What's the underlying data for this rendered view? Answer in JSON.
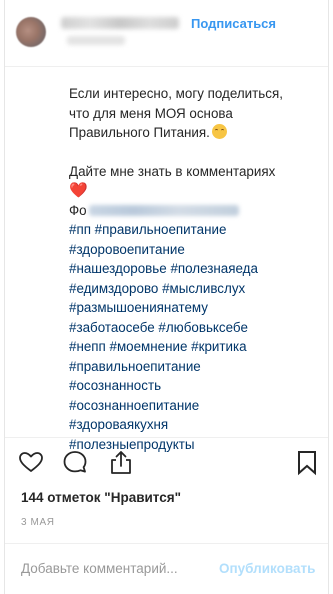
{
  "header": {
    "follow_label": "Подписаться"
  },
  "caption": {
    "lines": [
      "Если интересно, могу поделиться,",
      "что для меня МОЯ основа",
      "Правильного Питания."
    ],
    "ask_line": "Дайте мне знать в комментариях",
    "fo_prefix": "Фо",
    "hashtags": [
      "#пп #правильноепитание",
      "#здоровоепитание",
      "#нашездоровье #полезнаяеда",
      "#едимздорово #мысливслух",
      "#размышоениянатему",
      "#заботаосебе #любовьксебе",
      "#непп #моемнение #критика",
      "#правильноепитание",
      "#осознанность",
      "#осознанноепитание",
      "#здороваякухня",
      "#полезныепродукты"
    ]
  },
  "actions": {
    "like_icon": "heart-outline-icon",
    "comment_icon": "comment-bubble-icon",
    "share_icon": "share-upload-icon",
    "save_icon": "bookmark-icon"
  },
  "likes_label": "144 отметок \"Нравится\"",
  "date_label": "3 МАЯ",
  "comment": {
    "placeholder": "Добавьте комментарий...",
    "publish_label": "Опубликовать"
  },
  "colors": {
    "link_blue": "#3897f0",
    "hashtag": "#003569",
    "publish_disabled": "#b2dffc",
    "muted": "#999999"
  }
}
